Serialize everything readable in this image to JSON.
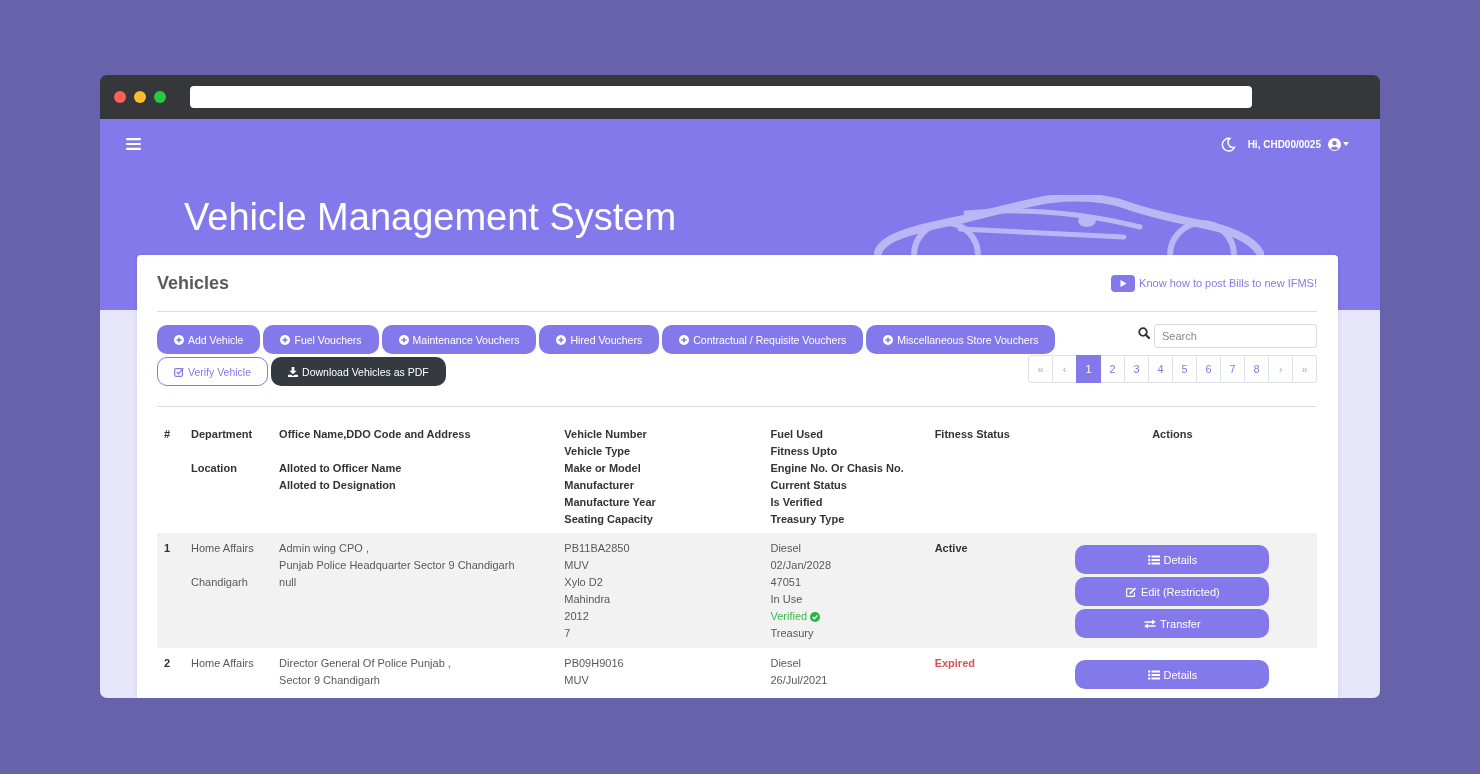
{
  "topbar": {
    "greeting": "Hi, CHD00/0025"
  },
  "banner": {
    "title": "Vehicle Management System"
  },
  "card": {
    "title": "Vehicles",
    "help_link": "Know how to post Bills to new IFMS!"
  },
  "toolbar": {
    "buttons": [
      {
        "kind": "add",
        "label": "Add Vehicle"
      },
      {
        "kind": "add",
        "label": "Fuel Vouchers"
      },
      {
        "kind": "add",
        "label": "Maintenance Vouchers"
      },
      {
        "kind": "add",
        "label": "Hired Vouchers"
      },
      {
        "kind": "add",
        "label": "Contractual / Requisite Vouchers"
      },
      {
        "kind": "add",
        "label": "Miscellaneous Store Vouchers"
      },
      {
        "kind": "verify",
        "label": "Verify Vehicle"
      },
      {
        "kind": "download",
        "label": "Download Vehicles as PDF"
      }
    ],
    "search": {
      "placeholder": "Search"
    },
    "pagination": [
      {
        "kind": "nav",
        "label": "«",
        "selected": false
      },
      {
        "kind": "nav",
        "label": "‹",
        "selected": false
      },
      {
        "kind": "page",
        "label": "1",
        "selected": true
      },
      {
        "kind": "page",
        "label": "2",
        "selected": false
      },
      {
        "kind": "page",
        "label": "3",
        "selected": false
      },
      {
        "kind": "page",
        "label": "4",
        "selected": false
      },
      {
        "kind": "page",
        "label": "5",
        "selected": false
      },
      {
        "kind": "page",
        "label": "6",
        "selected": false
      },
      {
        "kind": "page",
        "label": "7",
        "selected": false
      },
      {
        "kind": "page",
        "label": "8",
        "selected": false
      },
      {
        "kind": "nav",
        "label": "›",
        "selected": false
      },
      {
        "kind": "nav",
        "label": "»",
        "selected": false
      }
    ]
  },
  "table": {
    "columns": [
      {
        "kind": "text",
        "groups": [
          [
            "#"
          ]
        ]
      },
      {
        "kind": "text",
        "groups": [
          [
            "Department"
          ],
          [
            "Location"
          ]
        ]
      },
      {
        "kind": "text",
        "groups": [
          [
            "Office Name,DDO Code and Address"
          ],
          [
            "Alloted to Officer Name",
            "Alloted to Designation"
          ]
        ]
      },
      {
        "kind": "text",
        "groups": [
          [
            "Vehicle Number",
            "Vehicle Type",
            "Make or Model",
            "Manufacturer",
            "Manufacture Year",
            "Seating Capacity"
          ]
        ]
      },
      {
        "kind": "text",
        "groups": [
          [
            "Fuel Used",
            "Fitness Upto",
            "Engine No. Or Chasis No.",
            "Current Status",
            "Is Verified",
            "Treasury Type"
          ]
        ]
      },
      {
        "kind": "text",
        "groups": [
          [
            "Fitness Status"
          ]
        ]
      },
      {
        "kind": "actions",
        "groups": [
          [
            "Actions"
          ]
        ]
      }
    ],
    "rows": [
      {
        "number": "1",
        "department": "Home Affairs",
        "location": "Chandigarh",
        "office": [
          "Admin wing CPO ,",
          "Punjab Police Headquarter Sector 9 Chandigarh",
          "null"
        ],
        "vehicle": [
          "PB11BA2850",
          "MUV",
          "Xylo D2",
          "Mahindra",
          "2012",
          "7"
        ],
        "fuel": [
          "Diesel",
          "02/Jan/2028",
          "47051",
          "In Use"
        ],
        "verified": {
          "label": "Verified",
          "checked": true
        },
        "treasury": "Treasury",
        "fitness": {
          "label": "Active",
          "expired": false
        },
        "actions": [
          {
            "kind": "list",
            "label": "Details"
          },
          {
            "kind": "edit",
            "label": "Edit (Restricted)"
          },
          {
            "kind": "transfer",
            "label": "Transfer"
          }
        ]
      },
      {
        "number": "2",
        "department": "Home Affairs",
        "office": [
          "Director General Of Police Punjab ,",
          "Sector 9 Chandigarh"
        ],
        "vehicle": [
          "PB09H9016",
          "MUV"
        ],
        "fuel": [
          "Diesel",
          "26/Jul/2021"
        ],
        "fitness": {
          "label": "Expired",
          "expired": true
        },
        "actions": [
          {
            "kind": "list",
            "label": "Details"
          }
        ]
      }
    ]
  }
}
